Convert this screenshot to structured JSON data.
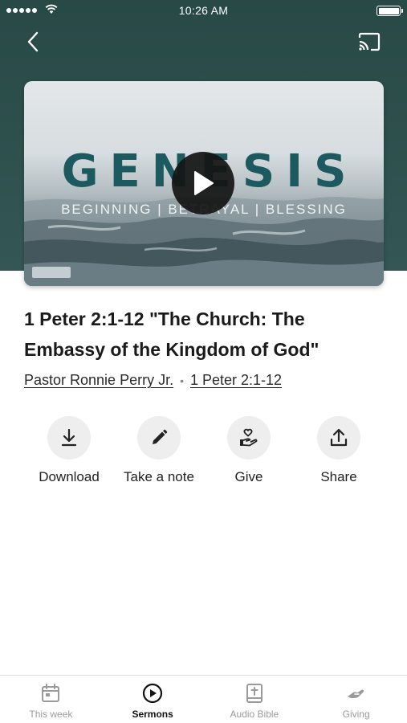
{
  "status_bar": {
    "time": "10:26 AM"
  },
  "icons": {
    "back": "chevron-left-icon",
    "cast": "cast-icon",
    "play": "play-icon",
    "download": "download-icon",
    "note": "pencil-icon",
    "give": "heart-hand-icon",
    "share": "share-icon"
  },
  "artwork": {
    "title": "GENESIS",
    "subtitle": "BEGINNING | BETRAYAL | BLESSING"
  },
  "sermon": {
    "title": "1 Peter 2:1-12 \"The Church: The Embassy of the Kingdom of God\"",
    "speaker": "Pastor Ronnie Perry Jr.",
    "separator": "•",
    "scripture": "1 Peter 2:1-12"
  },
  "actions": [
    {
      "label": "Download"
    },
    {
      "label": "Take a note"
    },
    {
      "label": "Give"
    },
    {
      "label": "Share"
    }
  ],
  "tabs": [
    {
      "label": "This week",
      "active": false
    },
    {
      "label": "Sermons",
      "active": true
    },
    {
      "label": "Audio Bible",
      "active": false
    },
    {
      "label": "Giving",
      "active": false
    }
  ],
  "colors": {
    "header": "#2e504d",
    "art_title": "#1d5a60",
    "action_circle": "#eeeeee",
    "tab_inactive": "#9a9a9a",
    "tab_active": "#111111"
  }
}
